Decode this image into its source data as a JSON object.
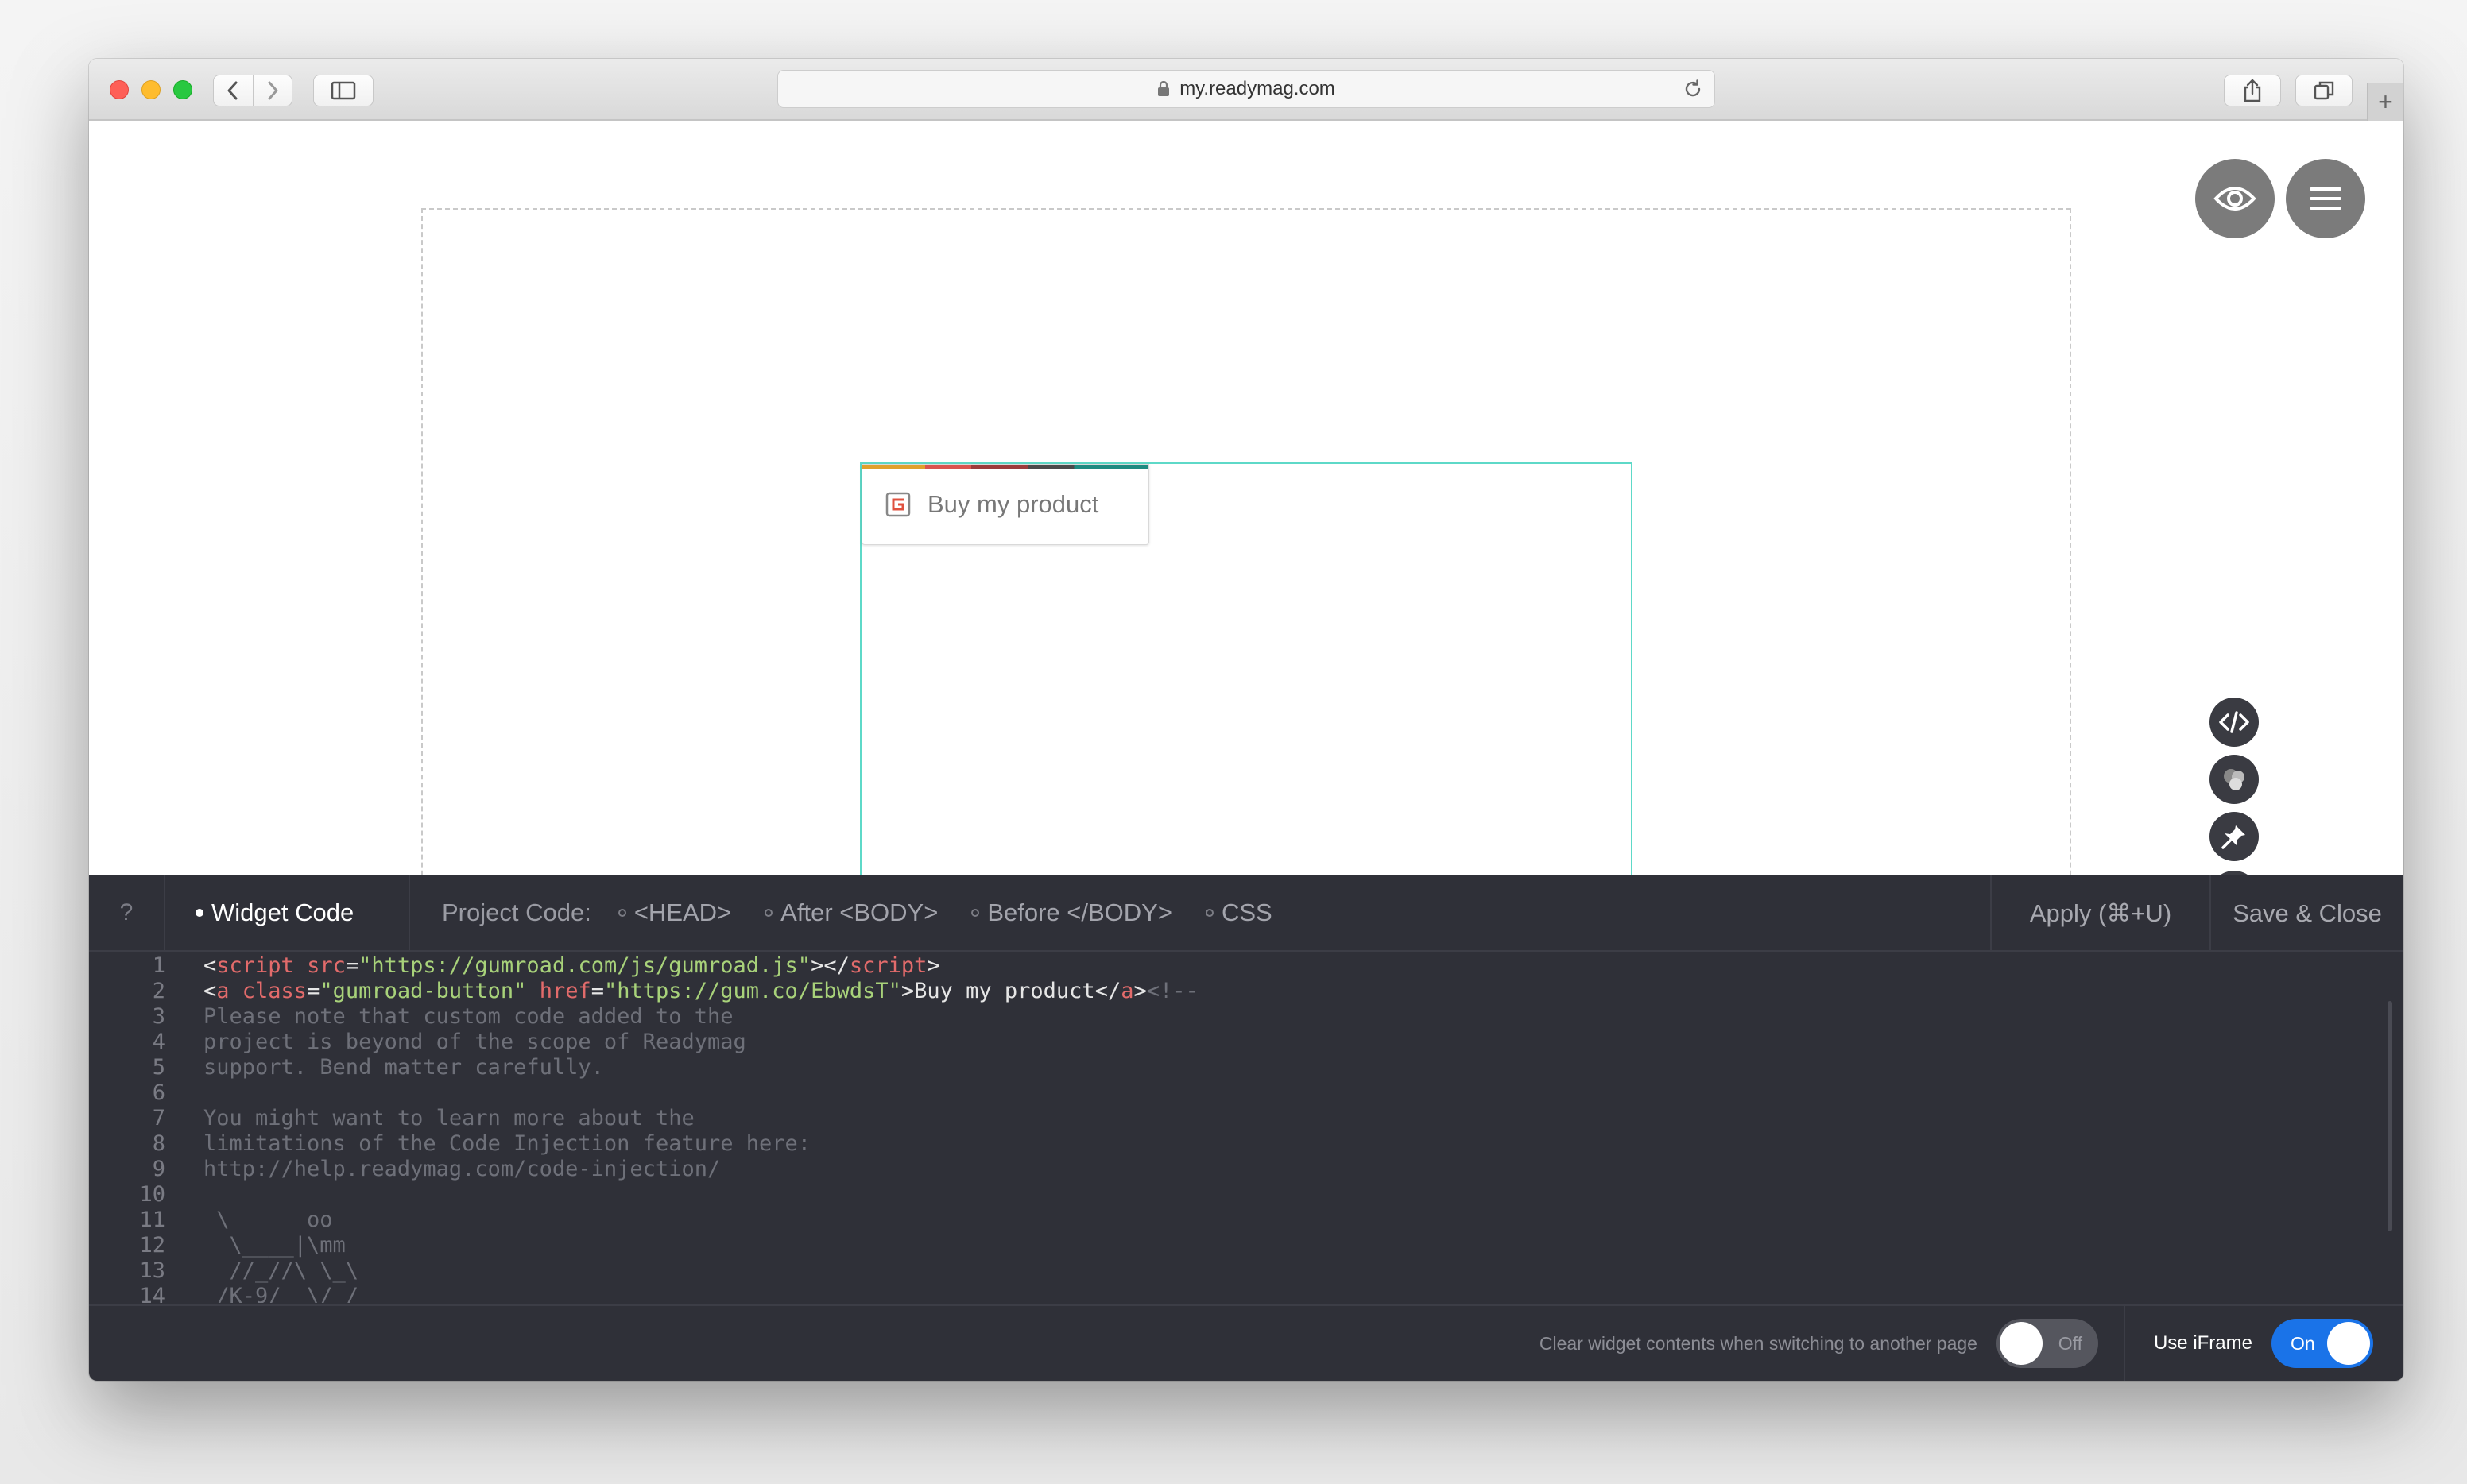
{
  "browser": {
    "url": "my.readymag.com",
    "new_tab": "+"
  },
  "canvas": {
    "gumroad_button_label": "Buy my product"
  },
  "editor": {
    "help_label": "?",
    "tab_widget_code": "Widget Code",
    "project_code_label": "Project Code:",
    "project_tabs": [
      "<HEAD>",
      "After <BODY>",
      "Before </BODY>",
      "CSS"
    ],
    "apply_label": "Apply (⌘+U)",
    "save_close_label": "Save & Close",
    "line_numbers": [
      "1",
      "2",
      "3",
      "4",
      "5",
      "6",
      "7",
      "8",
      "9",
      "10",
      "11",
      "12",
      "13",
      "14"
    ],
    "code": {
      "l1": {
        "open": "<",
        "tag": "script",
        "attr": " src",
        "eq": "=",
        "str": "\"https://gumroad.com/js/gumroad.js\"",
        "mid": "></",
        "tag2": "script",
        "close": ">"
      },
      "l2": {
        "open": "<",
        "tag": "a",
        "attr": " class",
        "eq": "=",
        "str": "\"gumroad-button\"",
        "attr2": " href",
        "eq2": "=",
        "str2": "\"https://gum.co/EbwdsT\"",
        "text": ">Buy my product</",
        "tag2": "a",
        "close": ">",
        "comment": "<!--"
      },
      "l3": "Please note that custom code added to the",
      "l4": "project is beyond of the scope of Readymag",
      "l5": "support. Bend matter carefully.",
      "l6": "",
      "l7": "You might want to learn more about the",
      "l8": "limitations of the Code Injection feature here:",
      "l9": "http://help.readymag.com/code-injection/",
      "l10": "",
      "l11": " \\      oo",
      "l12": "  \\____|\\mm",
      "l13": "  //_//\\ \\_\\",
      "l14": " /K-9/  \\/_/"
    },
    "footer": {
      "clear_label": "Clear widget contents when switching to another page",
      "clear_toggle": "Off",
      "iframe_label": "Use iFrame",
      "iframe_toggle": "On"
    }
  }
}
